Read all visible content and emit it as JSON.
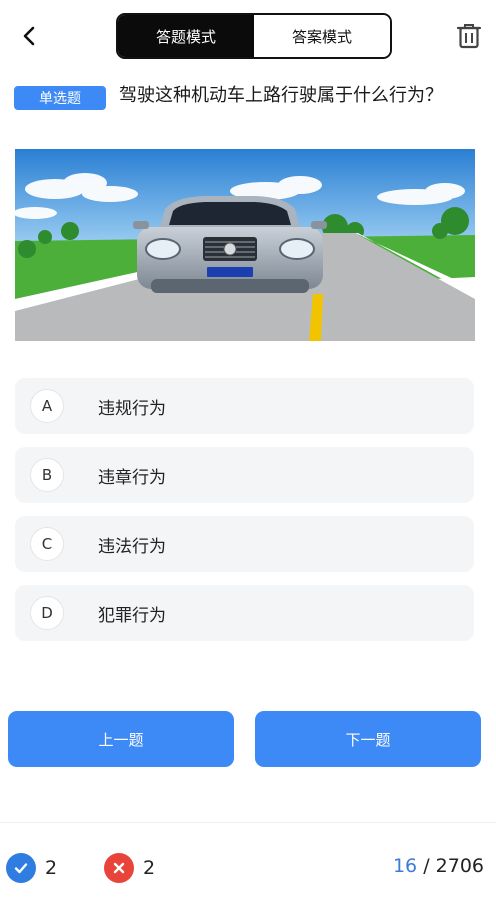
{
  "header": {
    "mode_tabs": [
      {
        "label": "答题模式",
        "active": true
      },
      {
        "label": "答案模式",
        "active": false
      }
    ],
    "back_icon": "chevron-left-icon",
    "trash_icon": "trash-icon"
  },
  "question": {
    "type_label": "单选题",
    "text": "驾驶这种机动车上路行驶属于什么行为？"
  },
  "options": [
    {
      "letter": "A",
      "text": "违规行为"
    },
    {
      "letter": "B",
      "text": "违章行为"
    },
    {
      "letter": "C",
      "text": "违法行为"
    },
    {
      "letter": "D",
      "text": "犯罪行为"
    }
  ],
  "nav": {
    "prev_label": "上一题",
    "next_label": "下一题"
  },
  "footer": {
    "correct_count": "2",
    "wrong_count": "2",
    "current": "16",
    "separator": " / ",
    "total": "2706"
  },
  "colors": {
    "accent": "#3d8af7",
    "correct": "#2f7de1",
    "wrong": "#e8443a",
    "progress_current": "#3d7bd8"
  }
}
